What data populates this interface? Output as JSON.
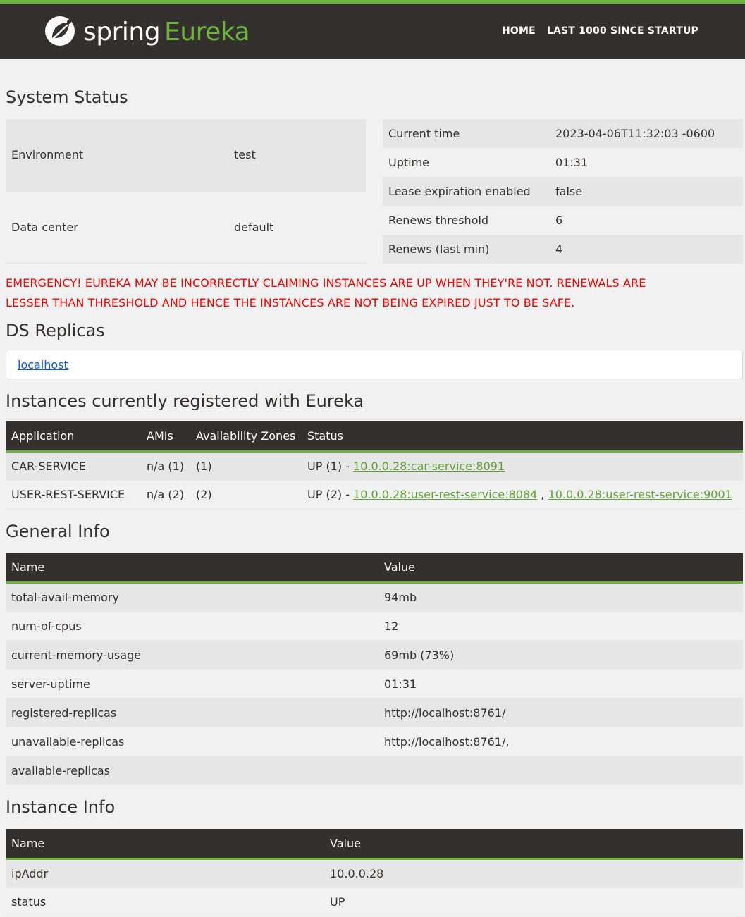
{
  "header": {
    "brand_spring": "spring",
    "brand_eureka": "Eureka",
    "nav": [
      "HOME",
      "LAST 1000 SINCE STARTUP"
    ],
    "colors": {
      "bar": "#34302d",
      "accent": "#6db33f"
    }
  },
  "system_status": {
    "title": "System Status",
    "left": [
      {
        "label": "Environment",
        "value": "test"
      },
      {
        "label": "Data center",
        "value": "default"
      }
    ],
    "right": [
      {
        "label": "Current time",
        "value": "2023-04-06T11:32:03 -0600"
      },
      {
        "label": "Uptime",
        "value": "01:31"
      },
      {
        "label": "Lease expiration enabled",
        "value": "false"
      },
      {
        "label": "Renews threshold",
        "value": "6"
      },
      {
        "label": "Renews (last min)",
        "value": "4"
      }
    ]
  },
  "emergency": {
    "line1": "EMERGENCY! EUREKA MAY BE INCORRECTLY CLAIMING INSTANCES ARE UP WHEN THEY'RE NOT. RENEWALS ARE",
    "line2": "LESSER THAN THRESHOLD AND HENCE THE INSTANCES ARE NOT BEING EXPIRED JUST TO BE SAFE.",
    "color": "#ff0000"
  },
  "ds_replicas": {
    "title": "DS Replicas",
    "link": "localhost"
  },
  "instances": {
    "title": "Instances currently registered with Eureka",
    "headers": [
      "Application",
      "AMIs",
      "Availability Zones",
      "Status"
    ],
    "rows": [
      {
        "application": "CAR-SERVICE",
        "amis": "n/a (1)",
        "zones": "(1)",
        "status_prefix": "UP (1) - ",
        "links": [
          "10.0.0.28:car-service:8091"
        ]
      },
      {
        "application": "USER-REST-SERVICE",
        "amis": "n/a (2)",
        "zones": "(2)",
        "status_prefix": "UP (2) - ",
        "links": [
          "10.0.0.28:user-rest-service:8084",
          "10.0.0.28:user-rest-service:9001"
        ],
        "separator": " , "
      }
    ]
  },
  "general_info": {
    "title": "General Info",
    "headers": [
      "Name",
      "Value"
    ],
    "rows": [
      {
        "name": "total-avail-memory",
        "value": "94mb"
      },
      {
        "name": "num-of-cpus",
        "value": "12"
      },
      {
        "name": "current-memory-usage",
        "value": "69mb (73%)"
      },
      {
        "name": "server-uptime",
        "value": "01:31"
      },
      {
        "name": "registered-replicas",
        "value": "http://localhost:8761/"
      },
      {
        "name": "unavailable-replicas",
        "value": "http://localhost:8761/,"
      },
      {
        "name": "available-replicas",
        "value": ""
      }
    ]
  },
  "instance_info": {
    "title": "Instance Info",
    "headers": [
      "Name",
      "Value"
    ],
    "rows": [
      {
        "name": "ipAddr",
        "value": "10.0.0.28"
      },
      {
        "name": "status",
        "value": "UP"
      }
    ]
  }
}
